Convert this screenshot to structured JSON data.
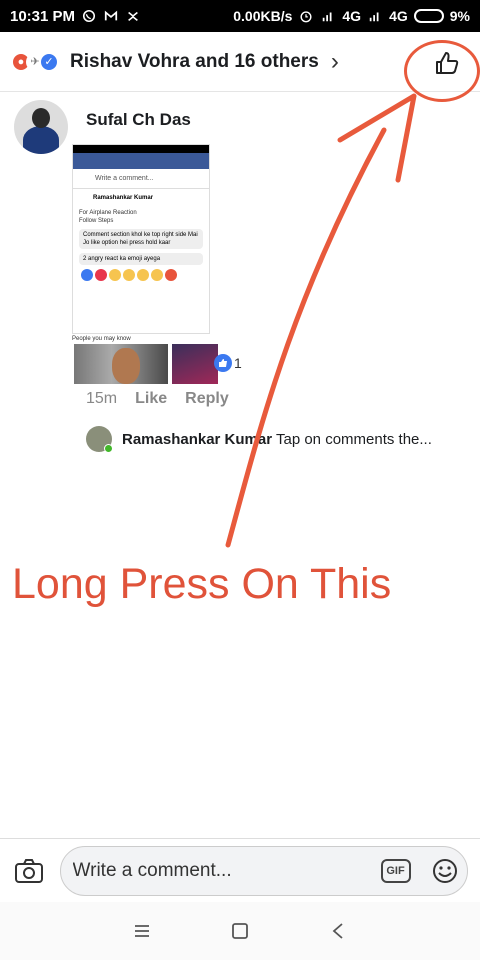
{
  "status_bar": {
    "time": "10:31 PM",
    "left_icons": [
      "whatsapp-icon",
      "gmail-icon",
      "notification-icon"
    ],
    "speed": "0.00KB/s",
    "network_1": "4G",
    "network_2": "4G",
    "battery": "9%"
  },
  "header": {
    "reactions": [
      "angry",
      "airplane",
      "like"
    ],
    "reactor_text": "Rishav Vohra and 16 others",
    "chevron_icon": "chevron-right-icon",
    "like_icon": "thumbs-up-icon"
  },
  "comment": {
    "author": "Sufal Ch Das",
    "screenshot": {
      "write_placeholder": "Write a comment...",
      "post_author": "Ramashankar Kumar",
      "post_text_1": "For Airplane Reaction",
      "post_text_2": "Follow Steps",
      "bubble_1": "Comment section khol ke top right side Mai Jo like option hei press hold kaar",
      "bubble_2": "2 angry react ka emoji ayega",
      "people_label": "People you may know"
    },
    "like_count": "1",
    "time": "15m",
    "like_action": "Like",
    "reply_action": "Reply"
  },
  "reply": {
    "author": "Ramashankar Kumar",
    "text": "Tap on comments the..."
  },
  "annotation": {
    "text": "Long Press On This",
    "color": "#e0533a"
  },
  "composer": {
    "placeholder": "Write a comment...",
    "gif_label": "GIF"
  },
  "nav_bar": [
    "menu-icon",
    "home-icon",
    "back-icon"
  ]
}
